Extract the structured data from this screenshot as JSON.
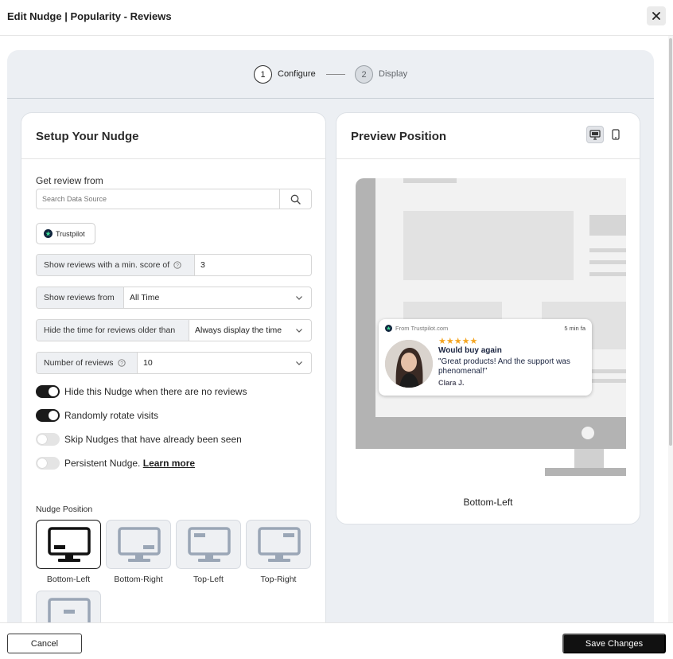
{
  "window": {
    "title": "Edit Nudge | Popularity - Reviews"
  },
  "stepper": {
    "steps": [
      {
        "number": "1",
        "label": "Configure"
      },
      {
        "number": "2",
        "label": "Display"
      }
    ]
  },
  "setup": {
    "title": "Setup Your Nudge",
    "review_source_label": "Get review from",
    "search_placeholder": "Search Data Source",
    "selected_source": "Trustpilot",
    "min_score": {
      "label": "Show reviews with a min. score of",
      "value": "3"
    },
    "reviews_from": {
      "label": "Show reviews from",
      "value": "All Time"
    },
    "hide_time": {
      "label": "Hide the time for reviews older than",
      "value": "Always display the time"
    },
    "num_reviews": {
      "label": "Number of reviews",
      "value": "10"
    },
    "toggles": [
      {
        "label": "Hide this Nudge when there are no reviews",
        "on": true
      },
      {
        "label": "Randomly rotate visits",
        "on": true
      },
      {
        "label": "Skip Nudges that have already been seen",
        "on": false
      },
      {
        "label": "Persistent Nudge.",
        "link": "Learn more",
        "on": false
      }
    ],
    "position_label": "Nudge Position",
    "positions": [
      {
        "label": "Bottom-Left",
        "selected": true
      },
      {
        "label": "Bottom-Right",
        "selected": false
      },
      {
        "label": "Top-Left",
        "selected": false
      },
      {
        "label": "Top-Right",
        "selected": false
      },
      {
        "label": "",
        "selected": false
      }
    ]
  },
  "preview": {
    "title": "Preview Position",
    "device": "desktop",
    "position_caption": "Bottom-Left",
    "nudge": {
      "source": "From Trustpilot.com",
      "time": "5 min fa",
      "rating": 5,
      "stars": "★★★★★",
      "title": "Would buy again",
      "text": "\"Great products! And the support was phenomenal!\"",
      "author": "Clara J."
    }
  },
  "footer": {
    "cancel_label": "Cancel",
    "save_label": "Save Changes"
  },
  "colors": {
    "accent": "#111111",
    "star": "#f5a623",
    "panel_bg": "#eceff3",
    "trustpilot": "#11253e"
  }
}
